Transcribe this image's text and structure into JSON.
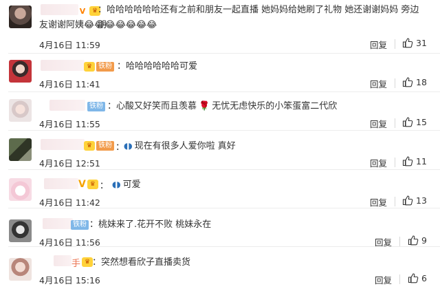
{
  "comments": [
    {
      "text": "：哈哈哈哈哈哈还有之前和朋友一起直播 她妈妈给她刷了礼物 她还谢谢妈妈 旁边朋",
      "text2": "友谢谢阿姨",
      "emojis": "😂😂😂😂😂😂😂",
      "date": "4月16日 11:59",
      "reply": "回复",
      "likes": "31"
    },
    {
      "badge": "铁粉",
      "text": "：哈哈哈哈哈哈可爱",
      "date": "4月16日 11:41",
      "reply": "回复",
      "likes": "18"
    },
    {
      "badge": "铁粉",
      "text": "：心酸又好笑而且羡慕",
      "text_after": "无忧无虑快乐的小笨蛋富二代欣",
      "date": "4月16日 11:55",
      "reply": "回复",
      "likes": "15"
    },
    {
      "badge": "铁粉",
      "text": "现在有很多人爱你啦 真好",
      "date": "4月16日 12:51",
      "reply": "回复",
      "likes": "11"
    },
    {
      "text": "可爱",
      "date": "4月16日 11:42",
      "reply": "回复",
      "likes": "13"
    },
    {
      "badge": "铁粉",
      "text": "：桃妹来了.花开不败 桃妹永在",
      "date": "4月16日 11:56",
      "reply": "回复",
      "likes": "9"
    },
    {
      "name_tail": "手",
      "text": "：突然想看欣子直播卖货",
      "date": "4月16日 15:16",
      "reply": "回复",
      "likes": "6"
    }
  ],
  "colors": {
    "text": "#333333",
    "divider": "#ececec",
    "vip": "#ff8200",
    "fan_orange": "#f29b4b",
    "fan_blue": "#7fb7e8"
  },
  "icons": {
    "like": "thumbs-up-icon",
    "crown": "crown-icon",
    "rose": "rose-icon",
    "fish": "fish-icon"
  }
}
